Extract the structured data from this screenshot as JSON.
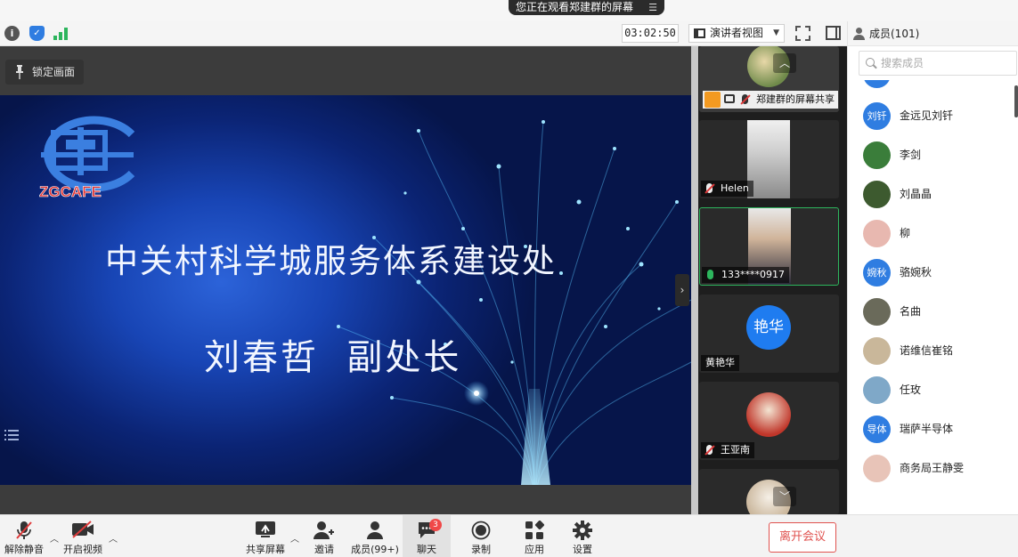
{
  "banner": {
    "text": "您正在观看郑建群的屏幕"
  },
  "toolbar": {
    "timer": "03:02:50",
    "view_mode": "演讲者视图"
  },
  "share": {
    "lock_view_label": "锁定画面",
    "slide": {
      "logo_text": "ZGCAFE",
      "title": "中关村科学城服务体系建设处",
      "speaker": "刘春哲  副处长"
    }
  },
  "video_tiles": [
    {
      "name": "郑建群的屏幕共享",
      "mic": "muted"
    },
    {
      "name": "Helen",
      "mic": "muted"
    },
    {
      "name": "133****0917",
      "mic": "on"
    },
    {
      "name": "黄艳华",
      "avatar_text": "艳华"
    },
    {
      "name": "王亚南",
      "mic": "muted"
    }
  ],
  "members_panel": {
    "title": "成员(101)",
    "search_placeholder": "搜索成员",
    "members": [
      {
        "name": "金远见刘钎",
        "avatar_text": "刘钎",
        "avatar_color": "#2f7de1"
      },
      {
        "name": "李剑",
        "avatar_color": "#3a7d3a"
      },
      {
        "name": "刘晶晶",
        "avatar_color": "#3d5a2f"
      },
      {
        "name": "柳",
        "avatar_color": "#e8b8b0"
      },
      {
        "name": "骆婉秋",
        "avatar_text": "婉秋",
        "avatar_color": "#2f7de1"
      },
      {
        "name": "名曲",
        "avatar_color": "#6a6a5a"
      },
      {
        "name": "诺维信崔铭",
        "avatar_color": "#c9b79a"
      },
      {
        "name": "任玫",
        "avatar_color": "#7fa8c8"
      },
      {
        "name": "瑞萨半导体",
        "avatar_text": "导体",
        "avatar_color": "#2f7de1"
      },
      {
        "name": "商务局王静雯",
        "avatar_color": "#e8c4b8"
      }
    ]
  },
  "controls": {
    "unmute": "解除静音",
    "start_video": "开启视频",
    "share_screen": "共享屏幕",
    "invite": "邀请",
    "members": "成员(99+)",
    "chat": "聊天",
    "chat_badge": "3",
    "record": "录制",
    "apps": "应用",
    "settings": "设置",
    "leave": "离开会议"
  }
}
